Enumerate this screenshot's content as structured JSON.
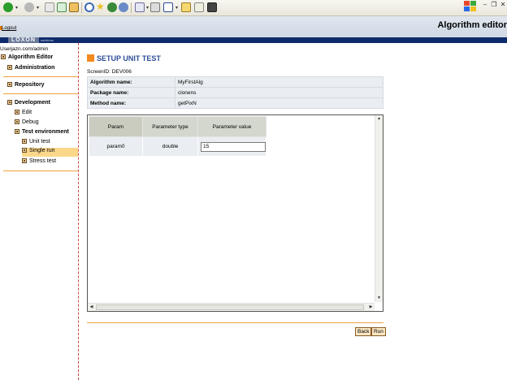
{
  "toolbar": {
    "icons": [
      "back-icon",
      "forward-icon",
      "stop-icon",
      "refresh-icon",
      "home-icon",
      "search-icon",
      "favorites-icon",
      "media-icon",
      "history-icon",
      "mail-icon",
      "print-icon",
      "edit-icon",
      "folder-icon",
      "messenger-icon"
    ],
    "colors": {
      "back": "#2a9d2a",
      "forward": "#b8b8b8"
    }
  },
  "header": {
    "logout": "Logout",
    "app_title": "Algorithm editor",
    "brand_logo": "LOXON",
    "brand_sub": "solutions"
  },
  "sidebar": {
    "user": "Userjazn.com/admin",
    "root": "Algorithm Editor",
    "items": {
      "administration": "Administration",
      "repository": "Repository",
      "development": "Development",
      "edit": "Edit",
      "debug": "Debug",
      "test_environment": "Test environment",
      "unit_test": "Unit test",
      "single_run": "Single run",
      "stress_test": "Stress test"
    }
  },
  "main": {
    "title": "SETUP UNIT TEST",
    "screen_id": "ScreenID: DEV006",
    "info": [
      {
        "label": "Algorithm name:",
        "value": "MyFirstAlg"
      },
      {
        "label": "Package name:",
        "value": "clonens"
      },
      {
        "label": "Method name:",
        "value": "getPixN"
      }
    ],
    "grid": {
      "headers": [
        "Param",
        "Parameter type",
        "Parameter value"
      ],
      "rows": [
        {
          "param": "param0",
          "type": "double",
          "value": "15"
        }
      ]
    },
    "buttons": {
      "back": "Back",
      "run": "Run"
    }
  },
  "accent_colors": {
    "orange": "#f28a1e",
    "navy": "#0d2a6b",
    "title_blue": "#2f4f9a"
  }
}
